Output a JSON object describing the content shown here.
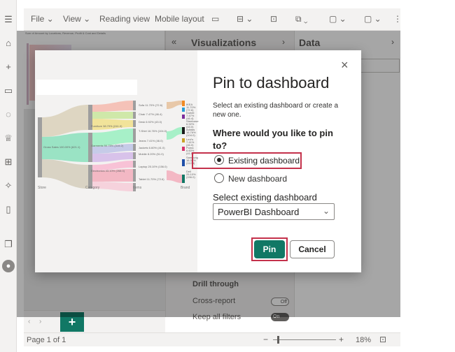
{
  "menubar": {
    "file": "File",
    "view": "View",
    "reading_view": "Reading view",
    "mobile_layout": "Mobile layout"
  },
  "canvas": {
    "report_title": "Sum of Amount by Locations, Revenue, Profit & Cost and Details"
  },
  "panes": {
    "visualizations": "Visualizations",
    "data": "Data",
    "drill_through": "Drill through",
    "cross_report": "Cross-report",
    "cross_report_state": "Off",
    "keep_all_filters": "Keep all filters",
    "keep_all_filters_state": "On"
  },
  "status": {
    "page": "Page 1 of 1",
    "zoom": "18%"
  },
  "preview": {
    "axes": [
      "Store",
      "Category",
      "Items",
      "Brand"
    ],
    "nodes": [
      "Gross Sales 100.00% (621.1)",
      "Furniture 38.79% (241.0)",
      "Garments 50.75% (315.2)",
      "Electronics 43.10% (268.0)",
      "Sofa 11.70% (72.6)",
      "Chair 7.47% (46.4)",
      "Desk 6.92% (43.0)",
      "T-Shirt 16.76% (104.0)",
      "Jeans 7.41% (46.0)",
      "Jackets 6.60% (41.0)",
      "Mobile 8.20% (51.0)",
      "Laptop 25.10% (156.0)",
      "Tablet 11.70% (72.6)",
      "IKEA 11.70% (72.6)",
      "Kartell 7.47% (46.4)",
      "Steelcase 6.92% (43.0)",
      "Adidas 16.76% (104.0)",
      "Levi's 7.41% (46.0)",
      "Puma 6.60% (41.0)",
      "Samsung 16.34% (112.5)",
      "Dell 25.10% (156.0)"
    ]
  },
  "dialog": {
    "title": "Pin to dashboard",
    "description": "Select an existing dashboard or create a new one.",
    "question": "Where would you like to pin to?",
    "option_existing": "Existing dashboard",
    "option_new": "New dashboard",
    "select_label": "Select existing dashboard",
    "select_value": "PowerBI Dashboard",
    "pin_button": "Pin",
    "cancel_button": "Cancel",
    "close_glyph": "×"
  },
  "colors": {
    "accent": "#117865",
    "highlight": "#c4314b"
  }
}
